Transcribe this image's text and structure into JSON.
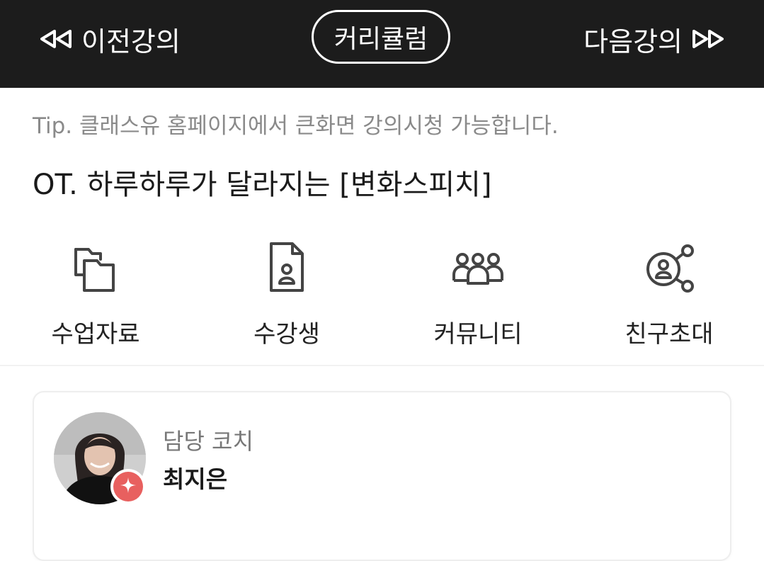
{
  "topbar": {
    "prev_label": "이전강의",
    "curriculum_label": "커리큘럼",
    "next_label": "다음강의",
    "bg_color": "#1c1c1c"
  },
  "tip": "Tip. 클래스유 홈페이지에서 큰화면 강의시청 가능합니다.",
  "lecture_title": "OT. 하루하루가 달라지는 [변화스피치]",
  "quick_menu": [
    {
      "label": "수업자료",
      "icon": "folder-icon"
    },
    {
      "label": "수강생",
      "icon": "student-document-icon"
    },
    {
      "label": "커뮤니티",
      "icon": "group-icon"
    },
    {
      "label": "친구초대",
      "icon": "share-user-icon"
    }
  ],
  "coach": {
    "role": "담당 코치",
    "name": "최지은",
    "badge_color": "#e8605f"
  }
}
